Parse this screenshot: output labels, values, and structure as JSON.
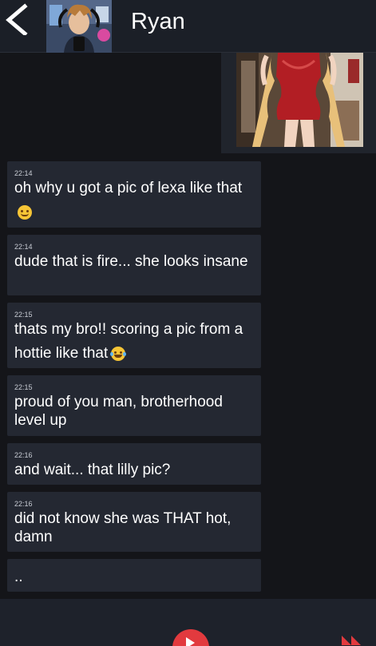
{
  "header": {
    "back_icon": "chevron-left-icon",
    "contact_name": "Ryan"
  },
  "messages": [
    {
      "time": "22:14",
      "text": "oh why u got a pic of lexa like that",
      "emoji": "smiling-face"
    },
    {
      "time": "22:14",
      "text": "dude that is fire... she looks insane"
    },
    {
      "time": "22:15",
      "text": "thats my bro!! scoring a pic from a hottie like that",
      "emoji": "laughing-face"
    },
    {
      "time": "22:15",
      "text": "proud of you man, brotherhood level up"
    },
    {
      "time": "22:16",
      "text": "and wait... that lilly pic?"
    },
    {
      "time": "22:16",
      "text": "did not know she was THAT hot, damn"
    },
    {
      "text": ".."
    }
  ],
  "footer": {
    "play_icon": "play-icon",
    "fast_forward_icon": "fast-forward-icon"
  },
  "colors": {
    "header_bg": "#1b1f27",
    "chat_bg": "#141519",
    "bubble_bg": "#242832",
    "accent": "#e23a3e"
  }
}
